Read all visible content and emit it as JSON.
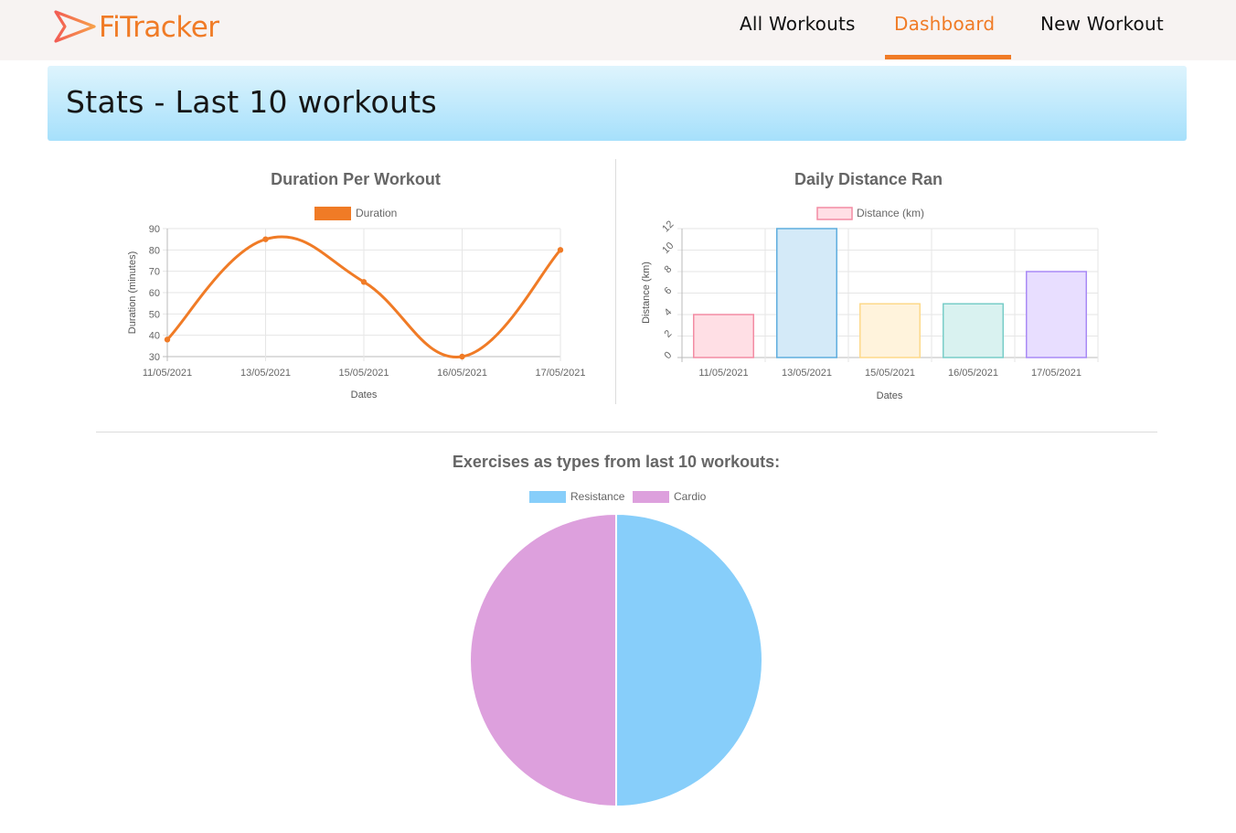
{
  "brand": {
    "name": "FiTracker",
    "logo_icon": "send-arrow-icon"
  },
  "nav": {
    "all_workouts": "All Workouts",
    "dashboard": "Dashboard",
    "new_workout": "New Workout",
    "active": "Dashboard"
  },
  "page": {
    "title": "Stats - Last 10 workouts"
  },
  "colors": {
    "accent": "#f07b26",
    "banner_top": "#def4fd",
    "banner_bottom": "#a6e0fb"
  },
  "chart_data": [
    {
      "type": "line",
      "title": "Duration Per Workout",
      "xlabel": "Dates",
      "ylabel": "Duration (minutes)",
      "categories": [
        "11/05/2021",
        "13/05/2021",
        "15/05/2021",
        "16/05/2021",
        "17/05/2021"
      ],
      "series": [
        {
          "name": "Duration",
          "values": [
            38,
            85,
            65,
            30,
            80
          ],
          "color": "#f07b26"
        }
      ],
      "ylim": [
        30,
        90
      ],
      "yticks": [
        30,
        40,
        50,
        60,
        70,
        80,
        90
      ],
      "grid": true,
      "legend": "top"
    },
    {
      "type": "bar",
      "title": "Daily Distance Ran",
      "xlabel": "Dates",
      "ylabel": "Distance (km)",
      "categories": [
        "11/05/2021",
        "13/05/2021",
        "15/05/2021",
        "16/05/2021",
        "17/05/2021"
      ],
      "series": [
        {
          "name": "Distance (km)",
          "values": [
            4,
            12,
            5,
            5,
            8
          ]
        }
      ],
      "bar_fills": [
        "#ffdfe5",
        "#d4eaf8",
        "#fff3dc",
        "#d9f2f0",
        "#e8deff"
      ],
      "bar_strokes": [
        "#f38ca3",
        "#5fadde",
        "#fdd98a",
        "#78cdc8",
        "#a98af5"
      ],
      "legend_fill": "#ffdfe5",
      "legend_stroke": "#f38ca3",
      "ylim": [
        0,
        12
      ],
      "yticks": [
        0,
        2,
        4,
        6,
        8,
        10,
        12
      ],
      "grid": true,
      "legend": "top"
    },
    {
      "type": "pie",
      "title": "Exercises as types from last 10 workouts:",
      "labels": [
        "Resistance",
        "Cardio"
      ],
      "values": [
        50,
        50
      ],
      "colors": [
        "#87cefa",
        "#dda0dd"
      ],
      "legend": "top"
    }
  ]
}
